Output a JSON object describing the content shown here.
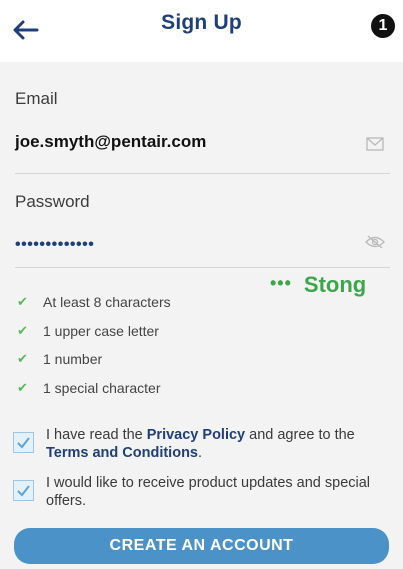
{
  "header": {
    "title": "Sign Up",
    "step": "1"
  },
  "email": {
    "label": "Email",
    "value": "joe.smyth@pentair.com",
    "icon": "mail-icon"
  },
  "password": {
    "label": "Password",
    "value_masked": "•••••••••••••",
    "icon": "eye-off-icon",
    "strength_dots": "•••",
    "strength_label": "Stong"
  },
  "requirements": [
    {
      "label": "At least 8 characters",
      "met": true
    },
    {
      "label": "1 upper case letter",
      "met": true
    },
    {
      "label": "1 number",
      "met": true
    },
    {
      "label": "1 special character",
      "met": true
    }
  ],
  "consent": {
    "privacy": {
      "text_before": "I have read the ",
      "privacy_link": "Privacy Policy",
      "text_middle": " and agree to the ",
      "terms_link": "Terms and Conditions",
      "text_after": ".",
      "checked": true
    },
    "marketing": {
      "text": "I would like to receive product updates and special offers.",
      "checked": true
    }
  },
  "actions": {
    "create_label": "CREATE AN ACCOUNT"
  },
  "colors": {
    "brand": "#1f3f7a",
    "strength": "#3ea64a",
    "button": "#4b92c9"
  }
}
